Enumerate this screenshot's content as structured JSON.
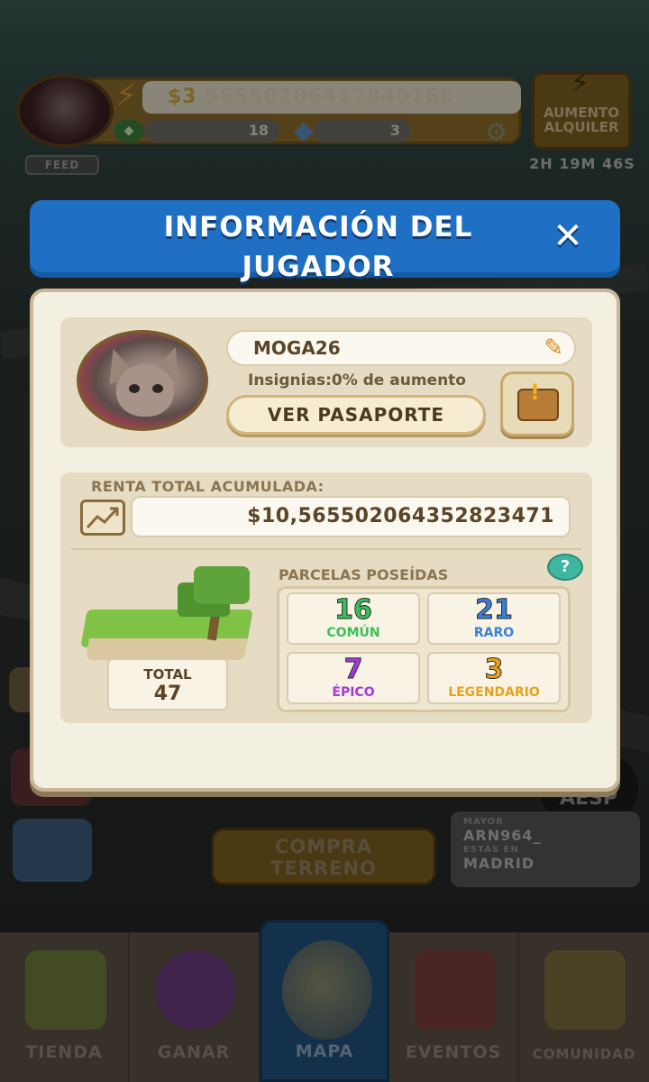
{
  "hud": {
    "money_symbol": "$3",
    "money_rest": "56550206417840166",
    "gems": "18",
    "diamonds": "3",
    "feed_label": "FEED",
    "boost_label_1": "AUMENTO",
    "boost_label_2": "ALQUILER",
    "timer": "2H 19M 46S"
  },
  "dialog": {
    "title_line1": "INFORMACIÓN DEL",
    "title_line2": "JUGADOR",
    "close": "✕",
    "player": {
      "name": "MOGA26",
      "insignias": "Insignias:0% de aumento",
      "passport_button": "VER PASAPORTE"
    },
    "rent": {
      "label": "RENTA TOTAL ACUMULADA:",
      "value": "$10,56550206435282347​1"
    },
    "parcels": {
      "label": "PARCELAS POSEÍDAS",
      "help": "?",
      "total_label": "TOTAL",
      "total_value": "47",
      "items": [
        {
          "value": "16",
          "label": "COMÚN",
          "color": "#3cbf5a"
        },
        {
          "value": "21",
          "label": "RARO",
          "color": "#3a7fd6"
        },
        {
          "value": "7",
          "label": "ÉPICO",
          "color": "#a33ad6"
        },
        {
          "value": "3",
          "label": "LEGENDARIO",
          "color": "#e6a21c"
        }
      ]
    }
  },
  "background": {
    "aesp": "AESP",
    "mayor_label": "MAYOR",
    "mayor_value": "ARN964_",
    "location_label": "ESTÁS EN",
    "location_value": "MADRID",
    "buy_line1": "COMPRA",
    "buy_line2": "TERRENO"
  },
  "nav": {
    "tabs": [
      "TIENDA",
      "GANAR",
      "MAPA",
      "EVENTOS",
      "COMUNIDAD"
    ]
  },
  "colors": {
    "header_blue": "#1f6fc4",
    "panel_cream": "#f3efe1",
    "nav_active": "#1f4f7a"
  }
}
